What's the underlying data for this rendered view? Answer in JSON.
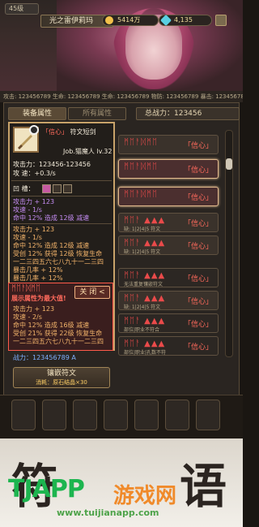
{
  "header": {
    "level": "45级",
    "player_name": "光之雷伊莉玛",
    "gold": "5414万",
    "gems": "4,135",
    "stat_strip": "攻击: 123456789  生命: 123456789  生命: 123456789  物防: 123456789  暴击: 123456789"
  },
  "tabs": {
    "equip": "装备属性",
    "all": "所有属性",
    "power_label": "总战力：123456"
  },
  "card": {
    "title_word": "「信心」",
    "title_type": "符文短剑",
    "job": "Job.猫魔人 lv.32",
    "atk": "攻击力：123456-123456",
    "spd": "攻  速：+0.3/s",
    "socket_label": "凹  槽：",
    "block1": [
      "攻击力 + 123",
      "攻速 - 1/s",
      "命中 12% 造成 12级 减速"
    ],
    "block2": [
      "攻击力 + 123",
      "攻速 - 1/s",
      "命中 12% 造成 12级 减速",
      "受创 12% 获得 12级 恢复生命",
      "一二三四五六七八九十一二三四",
      "暴击几率 + 12%",
      "暴击几率 + 12%"
    ],
    "popup_glyphs": "ᛗᛖᚨᛞᛗᛖ",
    "popup_hint": "展示属性为最大值!",
    "close_label": "关 闭 <",
    "popup_lines": [
      "攻击力 + 123",
      "攻速 - 2/s",
      "命中 12% 造成 16级 减速",
      "受创 21% 获得 22级 恢复生命",
      "一二三四五六七八九十一二三四"
    ],
    "power": "战力：123456789  A"
  },
  "inlay": {
    "label": "镶嵌符文",
    "cost": "消耗：原石结晶×30"
  },
  "runes": [
    {
      "glyphs": "ᛗᛖᚨᛞᛗᛖ",
      "word": "「信心」",
      "sub": ""
    },
    {
      "glyphs": "ᛗᛖᚨᛞᛗᛖ",
      "word": "「信心」",
      "sub": ""
    },
    {
      "glyphs": "ᛗᛖᚨᛞᛗᛖ",
      "word": "「信心」",
      "sub": ""
    },
    {
      "glyphs": "ᛗᛖᚨ ▲▲▲",
      "word": "「信心」",
      "sub": "缺: 1|2|4|5 符文"
    },
    {
      "glyphs": "ᛗᛖᚨ ▲▲▲",
      "word": "「信心」",
      "sub": "缺: 1|2|4|5 符文"
    },
    {
      "glyphs": "ᛗᛖᚨ ▲▲▲",
      "word": "「信心」",
      "sub": "无法重复镶嵌符文"
    },
    {
      "glyphs": "ᛗᛖᚨ ▲▲▲",
      "word": "「信心」",
      "sub": "缺: 1|2|4|5 符文"
    },
    {
      "glyphs": "ᛗᛖᚨ ▲▲▲",
      "word": "「信心」",
      "sub": "部位|职业不符合"
    },
    {
      "glyphs": "ᛗᛖᚨ ▲▲▲",
      "word": "「信心」",
      "sub": "部位|职业|孔数不符"
    }
  ],
  "footer": {
    "char_left": "符",
    "char_right": "语",
    "wm_logo": "TJAPP",
    "wm_text": "游戏网",
    "wm_url": "www.tuijianapp.com"
  },
  "colors": {
    "accent": "#ff6a5c",
    "gold": "#c8a36a"
  }
}
